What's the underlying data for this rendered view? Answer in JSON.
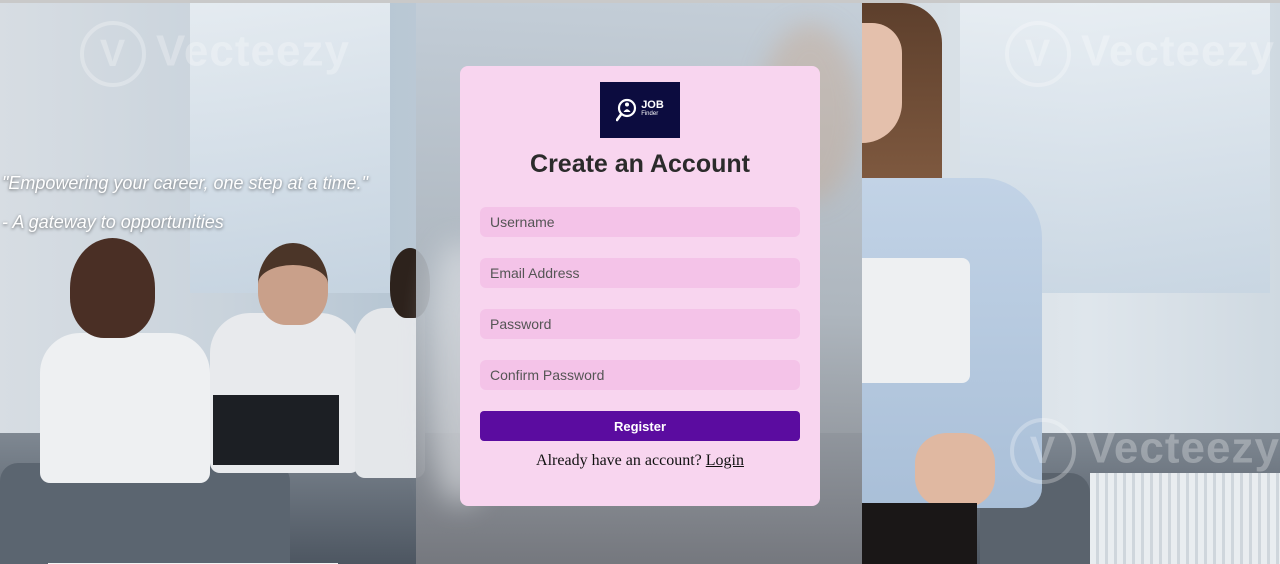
{
  "background": {
    "watermark": "Vecteezy"
  },
  "quote": {
    "line1": "\"Empowering your career, one step at a time.\"",
    "line2": "- A gateway to opportunities"
  },
  "logo": {
    "line1": "JOB",
    "line2": "Finder"
  },
  "form": {
    "title": "Create an Account",
    "username_placeholder": "Username",
    "email_placeholder": "Email Address",
    "password_placeholder": "Password",
    "confirm_placeholder": "Confirm Password",
    "submit_label": "Register",
    "login_prompt": "Already have an account?",
    "login_link": "Login"
  },
  "colors": {
    "card_bg": "#f8d5ef",
    "input_bg": "#f4c3e8",
    "button_bg": "#5b0ca0",
    "logo_bg": "#0c0c3f"
  }
}
